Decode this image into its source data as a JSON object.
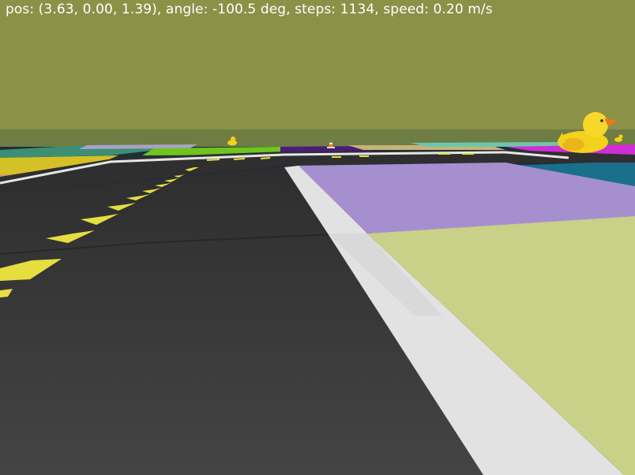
{
  "hud": {
    "status_text": "pos: (3.63, 0.00, 1.39), angle: -100.5 deg, steps: 1134, speed: 0.20 m/s"
  },
  "state": {
    "position": [
      3.63,
      0.0,
      1.39
    ],
    "angle_deg": -100.5,
    "steps": 1134,
    "speed_mps": 0.2
  },
  "scene": {
    "sky_color": "#8c9148",
    "horizon_color": "#6e7d44",
    "asphalt_color": "#3a3a3a",
    "lane_white_color": "#e6e6e6",
    "lane_yellow_color": "#e6de3f",
    "tile_lavender_color": "#a58fcf",
    "tile_khaki_color": "#c9d088",
    "duck_color": "#f2d21b",
    "beak_color": "#f07a16"
  }
}
